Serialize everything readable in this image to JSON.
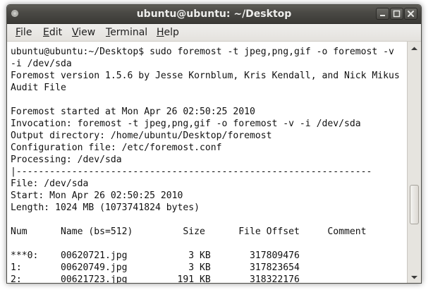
{
  "window": {
    "title": "ubuntu@ubuntu: ~/Desktop"
  },
  "menubar": {
    "items": [
      {
        "mnemonic": "F",
        "rest": "ile"
      },
      {
        "mnemonic": "E",
        "rest": "dit"
      },
      {
        "mnemonic": "V",
        "rest": "iew"
      },
      {
        "mnemonic": "T",
        "rest": "erminal"
      },
      {
        "mnemonic": "H",
        "rest": "elp"
      }
    ]
  },
  "terminal": {
    "lines": [
      "ubuntu@ubuntu:~/Desktop$ sudo foremost -t jpeg,png,gif -o foremost -v",
      "-i /dev/sda",
      "Foremost version 1.5.6 by Jesse Kornblum, Kris Kendall, and Nick Mikus",
      "Audit File",
      "",
      "Foremost started at Mon Apr 26 02:50:25 2010",
      "Invocation: foremost -t jpeg,png,gif -o foremost -v -i /dev/sda",
      "Output directory: /home/ubuntu/Desktop/foremost",
      "Configuration file: /etc/foremost.conf",
      "Processing: /dev/sda",
      "|----------------------------------------------------------------",
      "File: /dev/sda",
      "Start: Mon Apr 26 02:50:25 2010",
      "Length: 1024 MB (1073741824 bytes)",
      "",
      "Num      Name (bs=512)         Size      File Offset     Comment",
      "",
      "***0:    00620721.jpg           3 KB       317809476",
      "1:       00620749.jpg           3 KB       317823654",
      "2:       00621723.jpg         191 KB       318322176"
    ]
  },
  "colors": {
    "titlebar": "#3c3b37",
    "title_text": "#eeeeec",
    "menubar": "#edebe8",
    "terminal_bg": "#ffffff",
    "terminal_fg": "#111111"
  },
  "icons": [
    "window-menu-icon",
    "minimize-icon",
    "maximize-icon",
    "close-icon",
    "scroll-up-arrow-icon",
    "scroll-down-arrow-icon"
  ]
}
